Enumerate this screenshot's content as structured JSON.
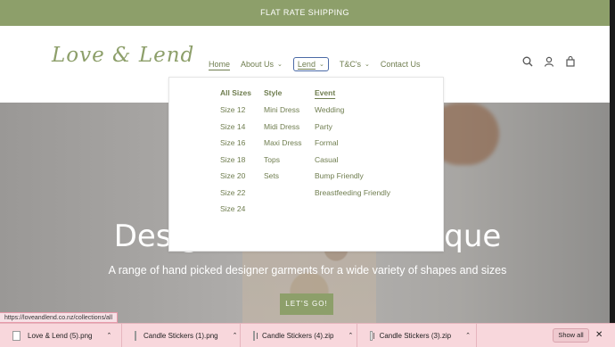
{
  "announcement": "FLAT RATE SHIPPING",
  "brand": {
    "logo_text": "Love & Lend",
    "accent": "#8d9f6a"
  },
  "nav": {
    "home": "Home",
    "about": "About Us",
    "lend": "Lend",
    "tcs": "T&C's",
    "contact": "Contact Us"
  },
  "header_icons": [
    "search-icon",
    "account-icon",
    "cart-icon"
  ],
  "mega_menu": {
    "sizes": {
      "heading": "All Sizes",
      "items": [
        "Size 12",
        "Size 14",
        "Size 16",
        "Size 18",
        "Size 20",
        "Size 22",
        "Size 24"
      ]
    },
    "style": {
      "heading": "Style",
      "items": [
        "Mini Dress",
        "Midi Dress",
        "Maxi Dress",
        "Tops",
        "Sets"
      ]
    },
    "event": {
      "heading": "Event",
      "items": [
        "Wedding",
        "Party",
        "Formal",
        "Casual",
        "Bump Friendly",
        "Breastfeeding Friendly"
      ]
    }
  },
  "hero": {
    "title": "Designer Rental Boutique",
    "subtitle": "A range of hand picked designer garments for a wide variety of shapes and sizes",
    "button": "LET'S GO!"
  },
  "status_url": "https://loveandlend.co.nz/collections/all",
  "downloads": [
    {
      "name": "Love & Lend (5).png",
      "kind": "image"
    },
    {
      "name": "Candle Stickers (1).png",
      "kind": "image"
    },
    {
      "name": "Candle Stickers (4).zip",
      "kind": "zip"
    },
    {
      "name": "Candle Stickers (3).zip",
      "kind": "zip"
    }
  ],
  "show_all": "Show all",
  "close_glyph": "✕"
}
